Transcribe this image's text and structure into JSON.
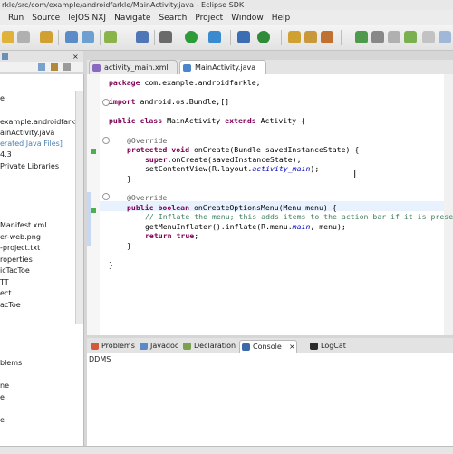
{
  "window": {
    "title": "rkle/src/com/example/androidfarkle/MainActivity.java - Eclipse SDK"
  },
  "menu": [
    "Run",
    "Source",
    "leJOS NXJ",
    "Navigate",
    "Search",
    "Project",
    "Window",
    "Help"
  ],
  "left_tree": [
    "e",
    "example.androidfarkle",
    "ainActivity.java",
    "erated Java Files]",
    "4.3",
    "Private Libraries",
    "Manifest.xml",
    "er-web.png",
    "-project.txt",
    "roperties",
    "icTacToe",
    "TT",
    "ect",
    "acToe",
    "blems",
    "ne",
    "e",
    "e"
  ],
  "editor_tabs": [
    {
      "label": "activity_main.xml",
      "active": false
    },
    {
      "label": "MainActivity.java",
      "active": true
    }
  ],
  "code": {
    "l1_kw": "package",
    "l1": " com.example.androidfarkle;",
    "l2_kw": "import",
    "l2": " android.os.Bundle;[]",
    "l3_kw1": "public class",
    "l3_a": " MainActivity ",
    "l3_kw2": "extends",
    "l3_b": " Activity {",
    "l4": "@Override",
    "l5_kw": "protected void",
    "l5": " onCreate(Bundle savedInstanceState) {",
    "l6_kw": "super",
    "l6": ".onCreate(savedInstanceState);",
    "l7_a": "setContentView(R.layout.",
    "l7_it": "activity_main",
    "l7_b": ");",
    "l8": "}",
    "l9": "@Override",
    "l10_kw": "public boolean",
    "l10": " onCreateOptionsMenu(Menu menu) {",
    "l11": "// Inflate the menu; this adds items to the action bar if it is prese",
    "l12_a": "getMenuInflater().inflate(R.menu.",
    "l12_it": "main",
    "l12_b": ", menu);",
    "l13_kw": "return true",
    "l13": ";",
    "l14": "}",
    "l15": "}",
    "cursor": "I"
  },
  "bottom_tabs": [
    "Problems",
    "Javadoc",
    "Declaration",
    "Console",
    "LogCat"
  ],
  "bottom_body": "DDMS"
}
